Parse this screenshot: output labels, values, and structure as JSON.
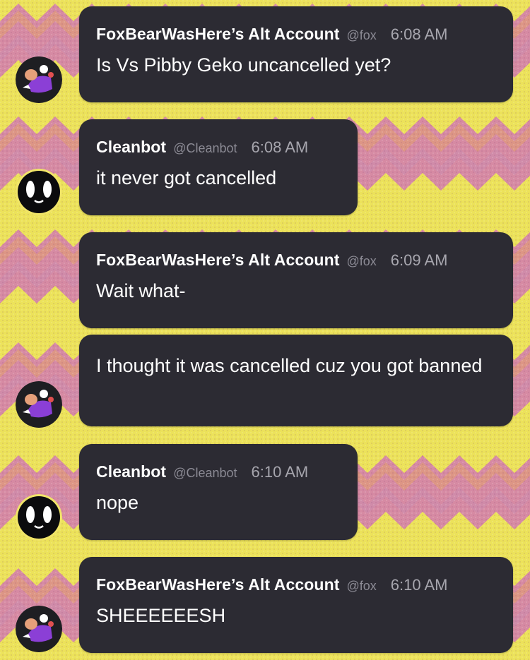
{
  "colors": {
    "bubble": "#2c2b33",
    "name": "#ffffff",
    "handle": "#8c8b95",
    "time": "#a7a6ae",
    "bg_yellow": "#ece25a",
    "bg_pink": "#d98aa0"
  },
  "messages": [
    {
      "avatar": "foxbear-avatar-icon",
      "author": "FoxBearWasHere’s Alt Account",
      "handle": "@fox",
      "time": "6:08 AM",
      "text": "Is Vs Pibby Geko uncancelled yet?"
    },
    {
      "avatar": "cleanbot-avatar-icon",
      "author": "Cleanbot",
      "handle": "@Cleanbot",
      "time": "6:08 AM",
      "text": "it never got cancelled"
    },
    {
      "avatar": "foxbear-avatar-icon",
      "author": "FoxBearWasHere’s Alt Account",
      "handle": "@fox",
      "time": "6:09 AM",
      "text": "Wait what-"
    },
    {
      "continuation": true,
      "text": "I thought it was cancelled cuz you got banned"
    },
    {
      "avatar": "cleanbot-avatar-icon",
      "author": "Cleanbot",
      "handle": "@Cleanbot",
      "time": "6:10 AM",
      "text": "nope"
    },
    {
      "avatar": "foxbear-avatar-icon",
      "author": "FoxBearWasHere’s Alt Account",
      "handle": "@fox",
      "time": "6:10 AM",
      "text": "SHEEEEEESH"
    }
  ]
}
